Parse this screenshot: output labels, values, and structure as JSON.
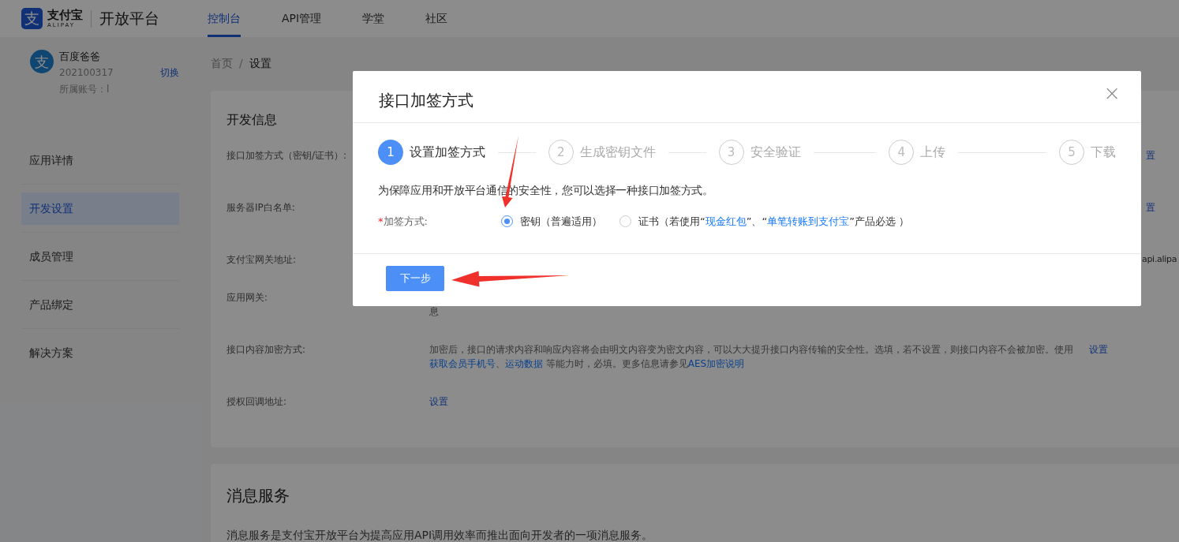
{
  "header": {
    "logo_mark": "支",
    "brand": "支付宝",
    "brand_latin": "ALIPAY",
    "product": "开放平台",
    "nav": [
      {
        "label": "控制台",
        "selected": true
      },
      {
        "label": "API管理",
        "selected": false
      },
      {
        "label": "学堂",
        "selected": false
      },
      {
        "label": "社区",
        "selected": false
      }
    ]
  },
  "account": {
    "avatar_mark": "支",
    "name": "百度爸爸",
    "id": "202100317",
    "switch": "切换",
    "owner": "所属账号：l"
  },
  "sidebar": {
    "items": [
      {
        "label": "应用详情",
        "selected": false
      },
      {
        "label": "开发设置",
        "selected": true
      },
      {
        "label": "成员管理",
        "selected": false
      },
      {
        "label": "产品绑定",
        "selected": false
      },
      {
        "label": "解决方案",
        "selected": false
      }
    ]
  },
  "breadcrumb": [
    {
      "label": "首页",
      "current": false
    },
    {
      "label": "设置",
      "current": true
    }
  ],
  "breadcrumb_separator": "/",
  "dev_info": {
    "title": "开发信息",
    "rows": [
      {
        "label": "接口加签方式（密钥/证书）:",
        "actions": [],
        "trailing": "置"
      },
      {
        "label": "服务器IP白名单:",
        "actions": [],
        "trailing": "置"
      },
      {
        "label": "支付宝网关地址:",
        "actions": [],
        "value_end": "api.alipa"
      },
      {
        "label": "应用网关:",
        "value": {
          "continued": true,
          "parts": [
            {
              "text": "息",
              "link": false
            }
          ]
        },
        "actions": []
      },
      {
        "label": "接口内容加密方式:",
        "value": {
          "continued": false,
          "parts": [
            {
              "text": "加密后，接口的请求内容和响应内容将会由明文内容变为密文内容，可以大大提升接口内容传输的安全性。选填，若不设置，则接口内容不会被加密。使用 ",
              "link": false
            },
            {
              "text": "获取会员手机号",
              "link": true
            },
            {
              "text": "、",
              "link": false
            },
            {
              "text": "运动数据",
              "link": true
            },
            {
              "text": " 等能力时，必填。更多信息请参见",
              "link": false
            },
            {
              "text": "AES加密说明",
              "link": true
            }
          ]
        },
        "actions": [
          "设置"
        ]
      },
      {
        "label": "授权回调地址:",
        "links": [
          "设置"
        ],
        "actions": []
      }
    ]
  },
  "message_service": {
    "title": "消息服务",
    "text": "消息服务是支付宝开放平台为提高应用API调用效率而推出面向开发者的一项消息服务。"
  },
  "dialog": {
    "title": "接口加签方式",
    "close": "×",
    "steps": [
      {
        "number": "1",
        "label": "设置加签方式",
        "active": true
      },
      {
        "number": "2",
        "label": "生成密钥文件",
        "active": false
      },
      {
        "number": "3",
        "label": "安全验证",
        "active": false
      },
      {
        "number": "4",
        "label": "上传",
        "active": false
      },
      {
        "number": "5",
        "label": "下载",
        "active": false
      }
    ],
    "description": "为保障应用和开放平台通信的安全性，您可以选择一种接口加签方式。",
    "field_label": "加签方式:",
    "required_mark": "*",
    "options": [
      {
        "selected": true,
        "parts": [
          {
            "text": "密钥（普遍适用）",
            "link": false
          }
        ]
      },
      {
        "selected": false,
        "parts": [
          {
            "text": "证书（若使用“",
            "link": false
          },
          {
            "text": "现金红包",
            "link": true
          },
          {
            "text": "”、“",
            "link": false
          },
          {
            "text": "单笔转账到支付宝",
            "link": true
          },
          {
            "text": "”产品必选 ）",
            "link": false
          }
        ]
      }
    ],
    "next_button": "下一步"
  }
}
